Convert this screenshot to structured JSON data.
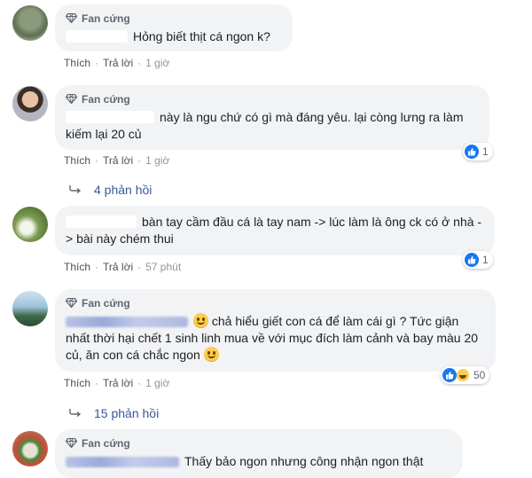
{
  "comments": [
    {
      "badge": "Fan cứng",
      "text": "Hỏng biết thịt cá ngon k?",
      "actions": {
        "like": "Thích",
        "reply": "Trả lời",
        "time": "1 giờ"
      }
    },
    {
      "badge": "Fan cứng",
      "text": "này là ngu chứ có gì mà đáng yêu. lại còng lưng ra làm kiếm lại 20 củ",
      "actions": {
        "like": "Thích",
        "reply": "Trả lời",
        "time": "1 giờ"
      },
      "reaction_count": "1",
      "replies": "4 phản hồi"
    },
    {
      "text": "bàn tay cầm đầu cá là tay nam -> lúc làm là ông ck có ở nhà -> bài này chém thui",
      "actions": {
        "like": "Thích",
        "reply": "Trả lời",
        "time": "57 phút"
      },
      "reaction_count": "1"
    },
    {
      "badge": "Fan cứng",
      "text_a": "chả hiểu giết con cá để làm cái gì ? Tức giận nhất thời hại chết 1 sinh linh mua về với mục đích làm cảnh và bay màu 20 củ, ăn con cá chắc ngon",
      "actions": {
        "like": "Thích",
        "reply": "Trả lời",
        "time": "1 giờ"
      },
      "reaction_count": "50",
      "replies": "15 phản hồi"
    },
    {
      "badge": "Fan cứng",
      "text": "Thấy bảo ngon nhưng công nhận ngon thật"
    }
  ],
  "colors": {
    "bubble": "#f2f3f5",
    "link": "#385898",
    "meta": "#90949c",
    "like": "#1877f2"
  },
  "icons": {
    "badge": "diamond-icon",
    "reaction_like": "thumbs-up-icon",
    "reaction_haha": "haha-emoji-icon",
    "replies_arrow": "reply-arrow-icon",
    "smile": "smile-emoji-icon",
    "wink": "wink-emoji-icon"
  }
}
